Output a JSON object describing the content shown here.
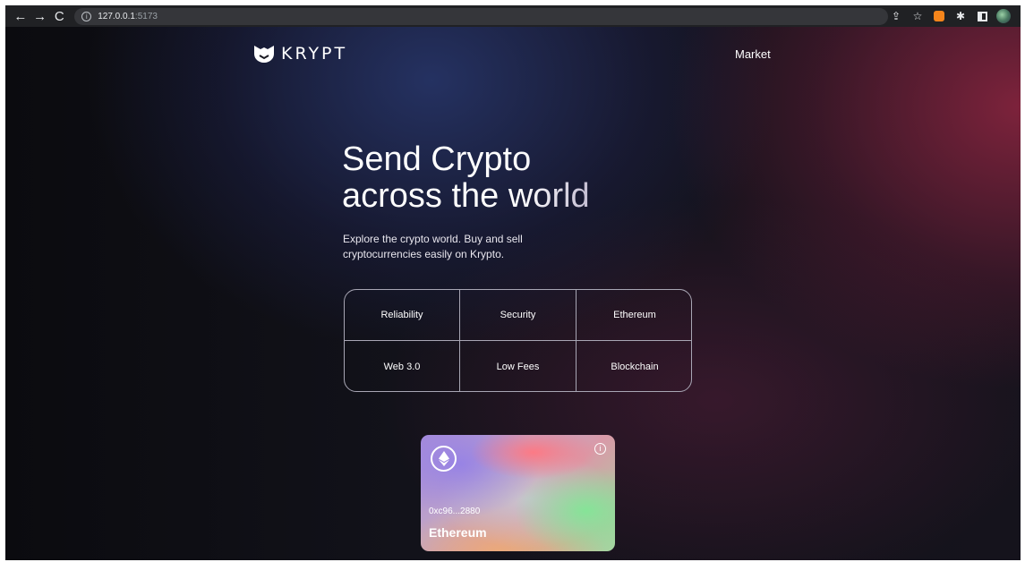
{
  "browser": {
    "url_host": "127.0.0.1",
    "url_port": ":5173",
    "nav": {
      "back": "←",
      "forward": "→",
      "reload": "C"
    }
  },
  "header": {
    "logo_text": "KRYPT",
    "nav_items": [
      "Market"
    ]
  },
  "hero": {
    "title_line1": "Send Crypto",
    "title_line2": "across the world",
    "subtitle": "Explore the crypto world. Buy and sell cryptocurrencies easily on Krypto."
  },
  "features": {
    "items": [
      "Reliability",
      "Security",
      "Ethereum",
      "Web 3.0",
      "Low Fees",
      "Blockchain"
    ]
  },
  "card": {
    "address": "0xc96...2880",
    "network": "Ethereum",
    "icon": "ethereum-icon",
    "info_icon": "info-icon"
  },
  "colors": {
    "page_bg": "#0f0f14",
    "accent_red": "#a0284a",
    "accent_blue": "#28376e",
    "text": "#ffffff"
  }
}
